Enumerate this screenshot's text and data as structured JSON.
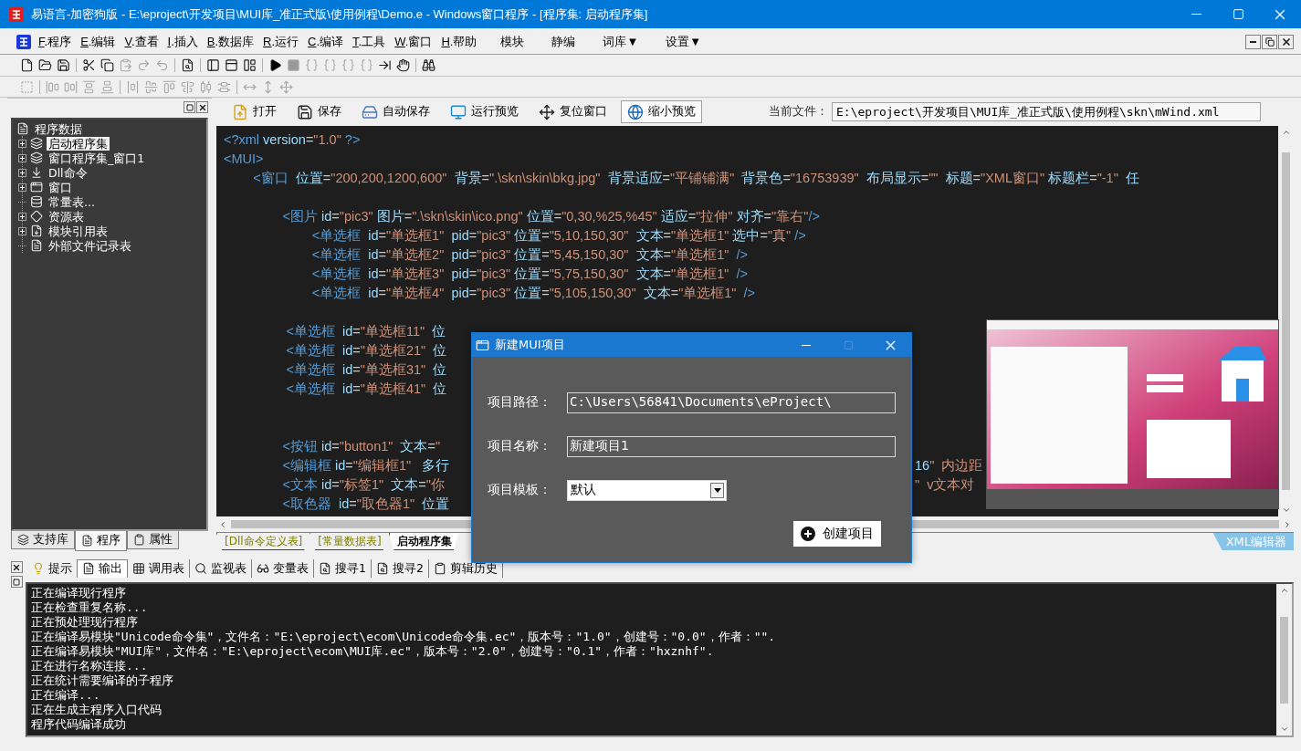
{
  "window": {
    "title": "易语言-加密狗版 - E:\\eproject\\开发项目\\MUI库_准正式版\\使用例程\\Demo.e - Windows窗口程序 - [程序集: 启动程序集]"
  },
  "menu": {
    "items": [
      "F.程序",
      "E.编辑",
      "V.查看",
      "I.插入",
      "B.数据库",
      "R.运行",
      "C.编译",
      "T.工具",
      "W.窗口",
      "H.帮助"
    ],
    "extras": [
      "模块",
      "静编",
      "词库▼",
      "设置▼"
    ]
  },
  "toolbar_1": [
    [
      {
        "disabled": false
      },
      {
        "disabled": false
      },
      {
        "disabled": false
      }
    ],
    [
      {
        "disabled": false
      },
      {
        "disabled": false
      },
      {
        "disabled": true
      },
      {
        "disabled": true
      },
      {
        "disabled": true
      }
    ],
    [
      {
        "disabled": false
      }
    ],
    [
      {
        "disabled": false
      },
      {
        "disabled": false
      },
      {
        "disabled": false
      }
    ],
    [
      {
        "disabled": false
      },
      {
        "disabled": true
      },
      {
        "disabled": true
      },
      {
        "disabled": true
      },
      {
        "disabled": true
      },
      {
        "disabled": true
      },
      {
        "disabled": false
      },
      {
        "disabled": false
      }
    ],
    [
      {
        "disabled": false
      }
    ]
  ],
  "toolbar_2": [
    [
      {
        "disabled": true
      }
    ],
    [
      {
        "disabled": true
      },
      {
        "disabled": true
      },
      {
        "disabled": true
      },
      {
        "disabled": true
      }
    ],
    [
      {
        "disabled": true
      },
      {
        "disabled": true
      },
      {
        "disabled": true
      },
      {
        "disabled": true
      },
      {
        "disabled": true
      },
      {
        "disabled": true
      }
    ],
    [
      {
        "disabled": true
      },
      {
        "disabled": true
      },
      {
        "disabled": true
      }
    ]
  ],
  "tree": {
    "label": "程序数据",
    "children": [
      {
        "label": "启动程序集",
        "expanded": false,
        "selected": true
      },
      {
        "label": "窗口程序集_窗口1",
        "expanded": false,
        "selected": false
      },
      {
        "label": "Dll命令",
        "expanded": false,
        "selected": false
      },
      {
        "label": "窗口",
        "expanded": false,
        "selected": false
      },
      {
        "label": "常量表...",
        "selected": false
      },
      {
        "label": "资源表",
        "expanded": false,
        "selected": false
      },
      {
        "label": "模块引用表",
        "expanded": false,
        "selected": false
      },
      {
        "label": "外部文件记录表",
        "selected": false
      }
    ]
  },
  "left_tabs": [
    {
      "label": "支持库",
      "selected": false
    },
    {
      "label": "程序",
      "selected": true
    },
    {
      "label": "属性",
      "selected": false
    }
  ],
  "editor_toolbar": {
    "buttons": [
      {
        "label": "打开",
        "pressed": false
      },
      {
        "label": "保存",
        "pressed": false
      },
      {
        "label": "自动保存",
        "pressed": false
      },
      {
        "label": "运行预览",
        "pressed": false
      },
      {
        "label": "复位窗口",
        "pressed": false
      },
      {
        "label": "缩小预览",
        "pressed": true
      }
    ],
    "file_label": "当前文件：",
    "file_path": "E:\\eproject\\开发项目\\MUI库_准正式版\\使用例程\\skn\\mWind.xml"
  },
  "code": {
    "lines": [
      {
        "kind": "code",
        "text": "<?xml version=\"1.0\" ?>"
      },
      {
        "kind": "code",
        "text": "<MUI>"
      },
      {
        "kind": "code",
        "text": "        <窗口  位置=\"200,200,1200,600\"  背景=\".\\skn\\skin\\bkg.jpg\"  背景适应=\"平铺铺满\"  背景色=\"16753939\"  布局显示=\"\"  标题=\"XML窗口\" 标题栏=\"-1\"  任"
      },
      {
        "kind": "blank"
      },
      {
        "kind": "code",
        "text": "                <图片 id=\"pic3\" 图片=\".\\skn\\skin\\ico.png\" 位置=\"0,30,%25,%45\" 适应=\"拉伸\" 对齐=\"靠右\"/>"
      },
      {
        "kind": "code",
        "text": "                        <单选框  id=\"单选框1\"  pid=\"pic3\" 位置=\"5,10,150,30\"  文本=\"单选框1\" 选中=\"真\" />"
      },
      {
        "kind": "code",
        "text": "                        <单选框  id=\"单选框2\"  pid=\"pic3\" 位置=\"5,45,150,30\"  文本=\"单选框1\"  />"
      },
      {
        "kind": "code",
        "text": "                        <单选框  id=\"单选框3\"  pid=\"pic3\" 位置=\"5,75,150,30\"  文本=\"单选框1\"  />"
      },
      {
        "kind": "code",
        "text": "                        <单选框  id=\"单选框4\"  pid=\"pic3\" 位置=\"5,105,150,30\"  文本=\"单选框1\"  />"
      },
      {
        "kind": "blank"
      },
      {
        "kind": "code",
        "text": "                 <单选框  id=\"单选框11\"  位"
      },
      {
        "kind": "code",
        "text": "                 <单选框  id=\"单选框21\"  位"
      },
      {
        "kind": "code",
        "text": "                 <单选框  id=\"单选框31\"  位"
      },
      {
        "kind": "code",
        "text": "                 <单选框  id=\"单选框41\"  位"
      },
      {
        "kind": "blank"
      },
      {
        "kind": "blank"
      },
      {
        "kind": "code",
        "text": "                <按钮 id=\"button1\"  文本=\""
      },
      {
        "kind": "code",
        "text": "                <编辑框 id=\"编辑框1\"   多行",
        "text_right": "16\"  内边距"
      },
      {
        "kind": "code",
        "text": "                <文本 id=\"标签1\"  文本=\"你",
        "text_right": "\"  v文本对"
      },
      {
        "kind": "code",
        "text": "                <取色器  id=\"取色器1\"  位置"
      }
    ]
  },
  "editor_tabs": [
    {
      "label": "[Dll命令定义表]",
      "selected": false
    },
    {
      "label": "[常量数据表]",
      "selected": false
    },
    {
      "label": "启动程序集",
      "selected": true
    }
  ],
  "editor_mode": "XML编辑器",
  "output_tabs": [
    {
      "label": "提示",
      "selected": false
    },
    {
      "label": "输出",
      "selected": true
    },
    {
      "label": "调用表",
      "selected": false
    },
    {
      "label": "监视表",
      "selected": false
    },
    {
      "label": "变量表",
      "selected": false
    },
    {
      "label": "搜寻1",
      "selected": false
    },
    {
      "label": "搜寻2",
      "selected": false
    },
    {
      "label": "剪辑历史",
      "selected": false
    }
  ],
  "output_lines": [
    "正在编译现行程序",
    "正在检查重复名称...",
    "正在预处理现行程序",
    "正在编译易模块\"Unicode命令集\"，文件名：\"E:\\eproject\\ecom\\Unicode命令集.ec\"，版本号：\"1.0\"，创建号：\"0.0\"，作者：\"\".",
    "正在编译易模块\"MUI库\"，文件名：\"E:\\eproject\\ecom\\MUI库.ec\"，版本号：\"2.0\"，创建号：\"0.1\"，作者：\"hxznhf\".",
    "正在进行名称连接...",
    "正在统计需要编译的子程序",
    "正在编译...",
    "正在生成主程序入口代码",
    "程序代码编译成功"
  ],
  "dialog": {
    "title": "新建MUI项目",
    "maximize_disabled": true,
    "fields": [
      {
        "label": "项目路径：",
        "value": "C:\\Users\\56841\\Documents\\eProject\\",
        "kind": "text"
      },
      {
        "label": "项目名称：",
        "value": "新建项目1",
        "kind": "text"
      },
      {
        "label": "项目模板：",
        "value": "默认",
        "kind": "select"
      }
    ],
    "button": "创建项目"
  }
}
